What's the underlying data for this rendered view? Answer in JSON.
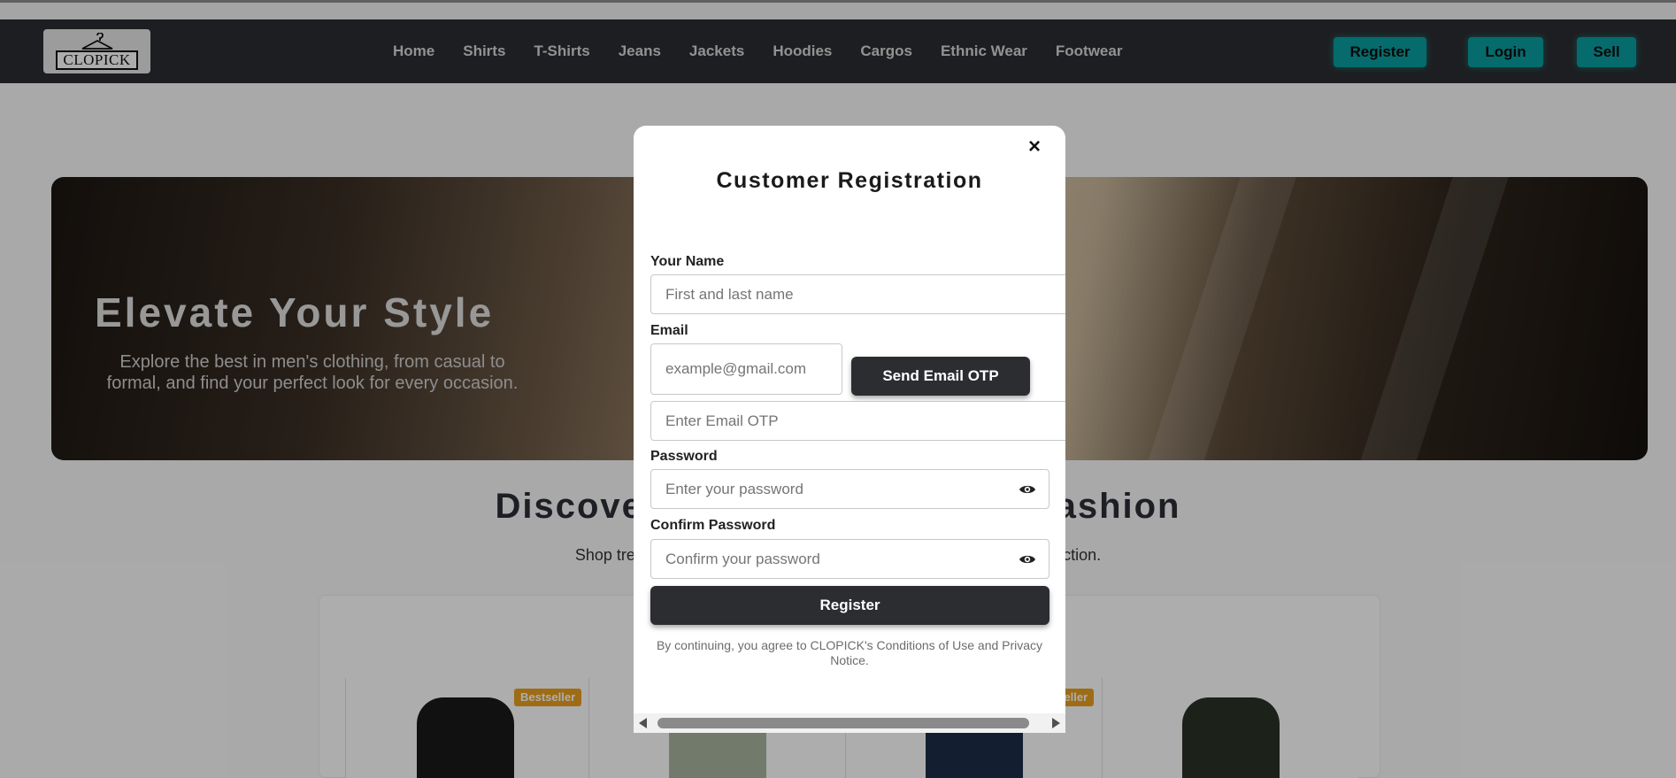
{
  "header": {
    "logo_text": "CLOPICK",
    "nav": [
      "Home",
      "Shirts",
      "T-Shirts",
      "Jeans",
      "Jackets",
      "Hoodies",
      "Cargos",
      "Ethnic Wear",
      "Footwear"
    ],
    "register_label": "Register",
    "login_label": "Login",
    "sell_label": "Sell",
    "accent_color": "#0a9ea0"
  },
  "hero": {
    "title": "Elevate Your Style",
    "subtitle": "Explore the best in men's clothing, from casual to formal, and find your perfect look for every occasion."
  },
  "discover": {
    "title": "Discover the Latest in Men's Fashion",
    "subtitle": "Shop trending styles and must-have essentials from our curated collection."
  },
  "products": {
    "badges": [
      "Bestseller",
      "Bestseller"
    ]
  },
  "modal": {
    "close_icon": "×",
    "title": "Customer Registration",
    "name_label": "Your Name",
    "name_placeholder": "First and last name",
    "email_label": "Email",
    "email_placeholder": "example@gmail.com",
    "send_otp_label": "Send Email OTP",
    "otp_placeholder": "Enter Email OTP",
    "password_label": "Password",
    "password_placeholder": "Enter your password",
    "confirm_label": "Confirm Password",
    "confirm_placeholder": "Confirm your password",
    "register_label": "Register",
    "terms": "By continuing, you agree to CLOPICK's Conditions of Use and Privacy Notice.",
    "button_color": "#2b2d31"
  }
}
